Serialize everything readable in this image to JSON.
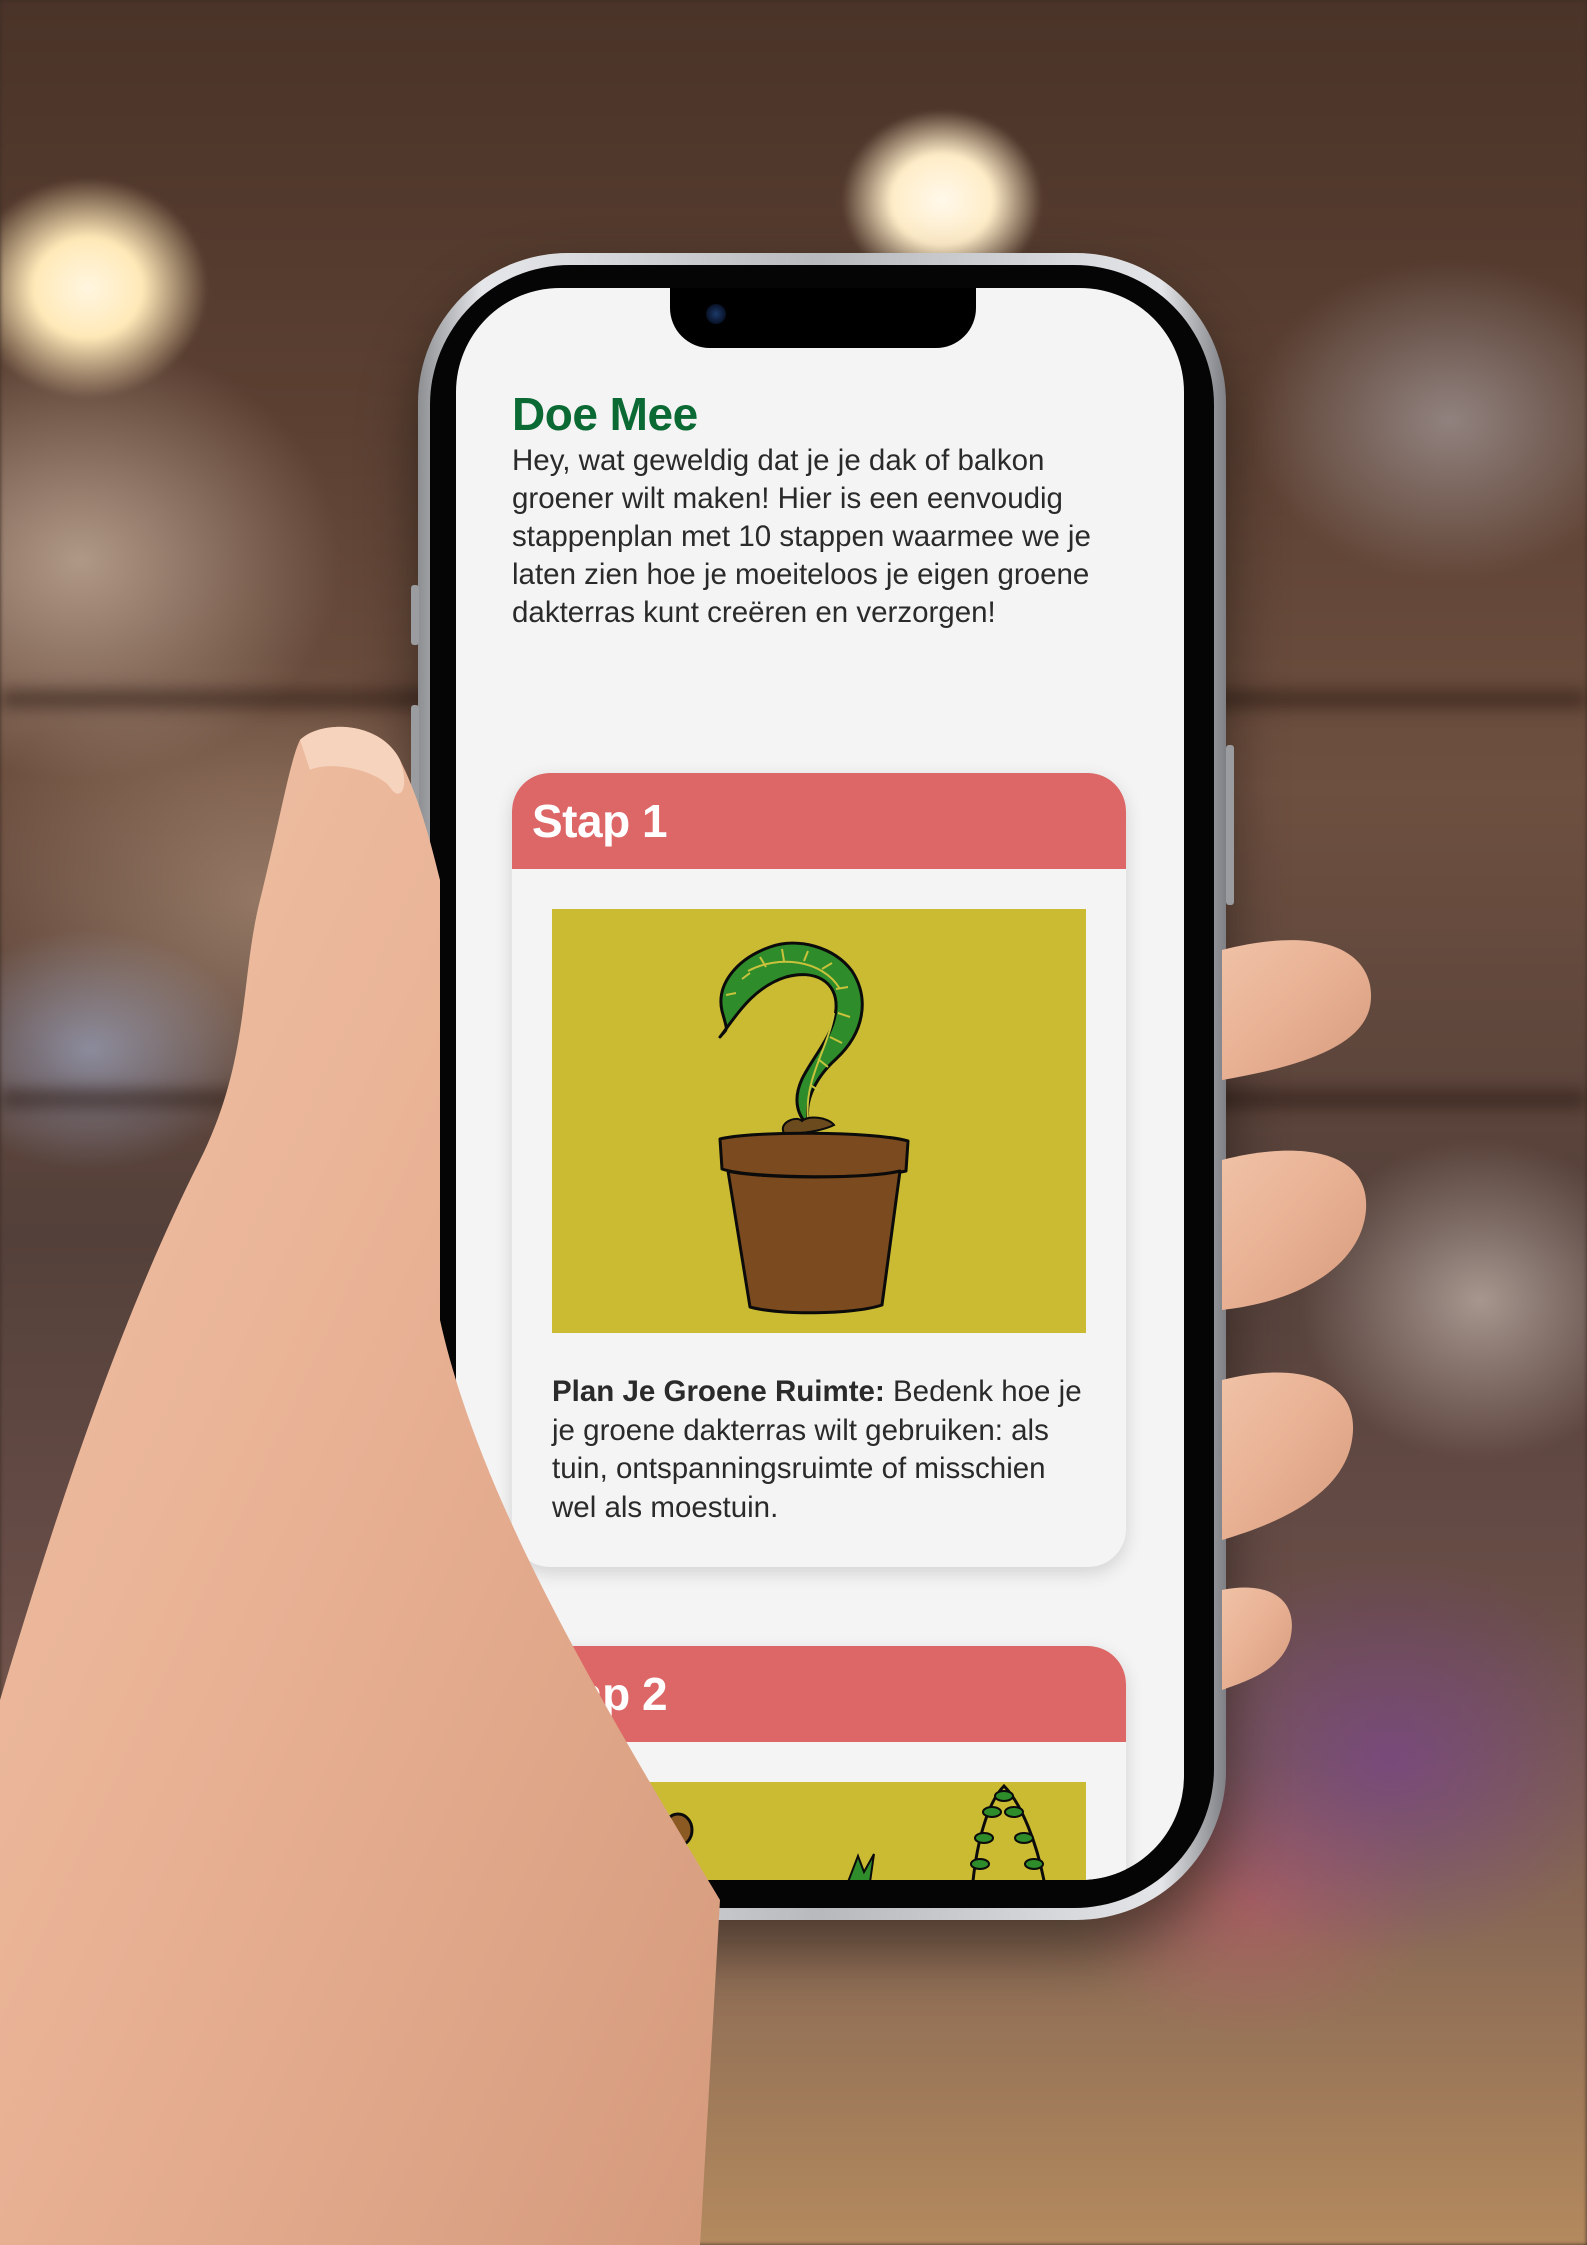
{
  "page": {
    "title": "Doe Mee",
    "intro": "Hey, wat geweldig dat je je dak of balkon groener wilt maken! Hier is een eenvoudig stappenplan met 10 stappen waarmee we je laten zien hoe je moeiteloos je eigen groene dakterras kunt creëren en verzorgen!"
  },
  "steps": [
    {
      "title": "Stap 1",
      "illustration": "plant-in-pot-illustration",
      "heading": "Plan Je Groene Ruimte:",
      "text": "Bedenk hoe je je groene dakterras wilt gebruiken: als tuin, ontspanningsruimte of misschien wel als moestuin."
    },
    {
      "title": "Stap 2",
      "illustration": "plants-illustration"
    }
  ],
  "colors": {
    "title_green": "#0b6a34",
    "step_header": "#dd6666",
    "illustration_bg": "#cbbb33",
    "page_bg": "#f4f4f4"
  }
}
